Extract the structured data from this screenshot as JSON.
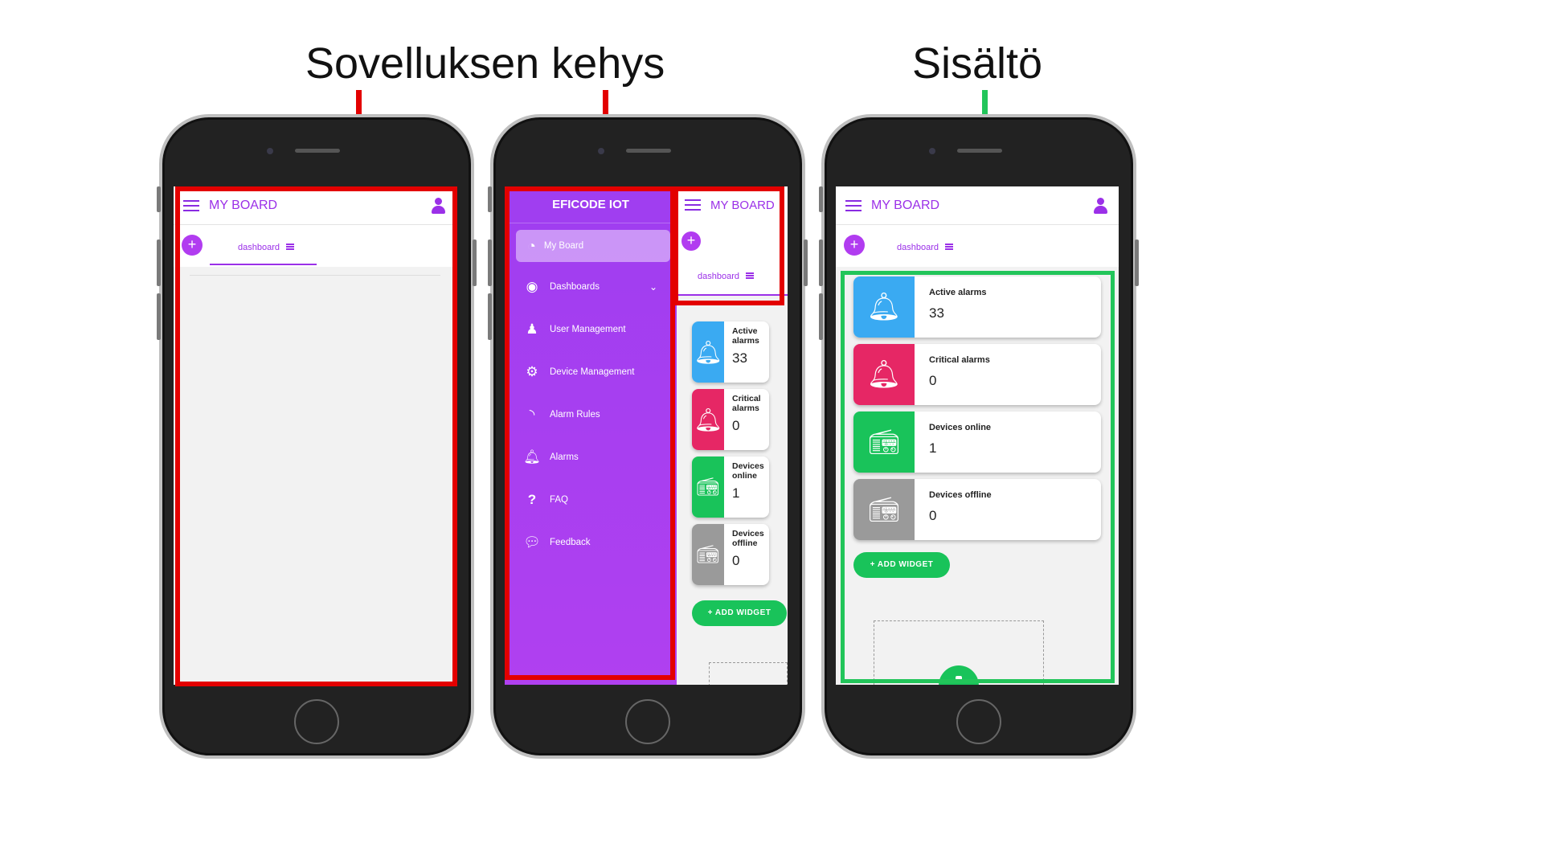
{
  "labels": {
    "left": "Sovelluksen kehys",
    "right": "Sisältö"
  },
  "colors": {
    "purple": "#9b30e8",
    "frame_red": "#e30000",
    "content_green": "#22c55a",
    "alarm_blue": "#3aaaf2",
    "critical_red": "#e62765",
    "online_green": "#19c35a",
    "offline_gray": "#9a9a9a"
  },
  "app": {
    "title": "MY BOARD",
    "tab_label": "dashboard",
    "add_widget": "+ ADD WIDGET"
  },
  "drawer": {
    "header": "EFICODE IOT",
    "items": [
      {
        "label": "My Board",
        "icon": "gauge-icon"
      },
      {
        "label": "Dashboards",
        "icon": "eye-icon"
      },
      {
        "label": "User Management",
        "icon": "users-icon"
      },
      {
        "label": "Device Management",
        "icon": "gears-icon"
      },
      {
        "label": "Alarm Rules",
        "icon": "rss-icon"
      },
      {
        "label": "Alarms",
        "icon": "bell-icon"
      },
      {
        "label": "FAQ",
        "icon": "question-icon"
      },
      {
        "label": "Feedback",
        "icon": "chat-icon"
      }
    ]
  },
  "widgets": [
    {
      "label": "Active alarms",
      "label_l1": "Active",
      "label_l2": "alarms",
      "value": "33",
      "icon": "bell-icon"
    },
    {
      "label": "Critical alarms",
      "label_l1": "Critical",
      "label_l2": "alarms",
      "value": "0",
      "icon": "bell-icon"
    },
    {
      "label": "Devices online",
      "label_l1": "Devices",
      "label_l2": "online",
      "value": "1",
      "icon": "router-icon"
    },
    {
      "label": "Devices offline",
      "label_l1": "Devices",
      "label_l2": "offline",
      "value": "0",
      "icon": "router-icon"
    }
  ]
}
